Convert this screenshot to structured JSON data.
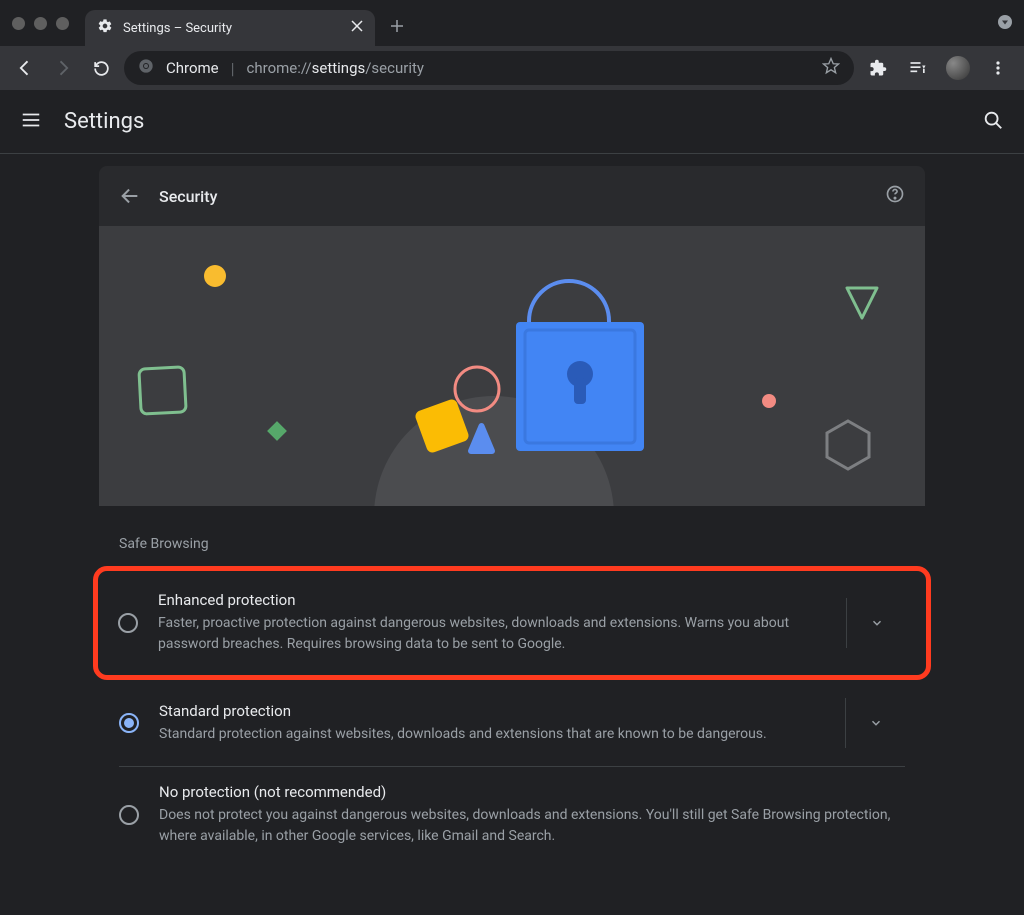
{
  "window": {
    "tab_title": "Settings – Security"
  },
  "omnibox": {
    "app_label": "Chrome",
    "url_prefix": "chrome://",
    "url_bold": "settings",
    "url_suffix": "/security"
  },
  "app": {
    "title": "Settings"
  },
  "section": {
    "title": "Security"
  },
  "safe_browsing": {
    "label": "Safe Browsing",
    "options": [
      {
        "title": "Enhanced protection",
        "desc": "Faster, proactive protection against dangerous websites, downloads and extensions. Warns you about password breaches. Requires browsing data to be sent to Google.",
        "selected": false,
        "expandable": true,
        "highlighted": true
      },
      {
        "title": "Standard protection",
        "desc": "Standard protection against websites, downloads and extensions that are known to be dangerous.",
        "selected": true,
        "expandable": true,
        "highlighted": false
      },
      {
        "title": "No protection (not recommended)",
        "desc": "Does not protect you against dangerous websites, downloads and extensions. You'll still get Safe Browsing protection, where available, in other Google services, like Gmail and Search.",
        "selected": false,
        "expandable": false,
        "highlighted": false
      }
    ]
  }
}
